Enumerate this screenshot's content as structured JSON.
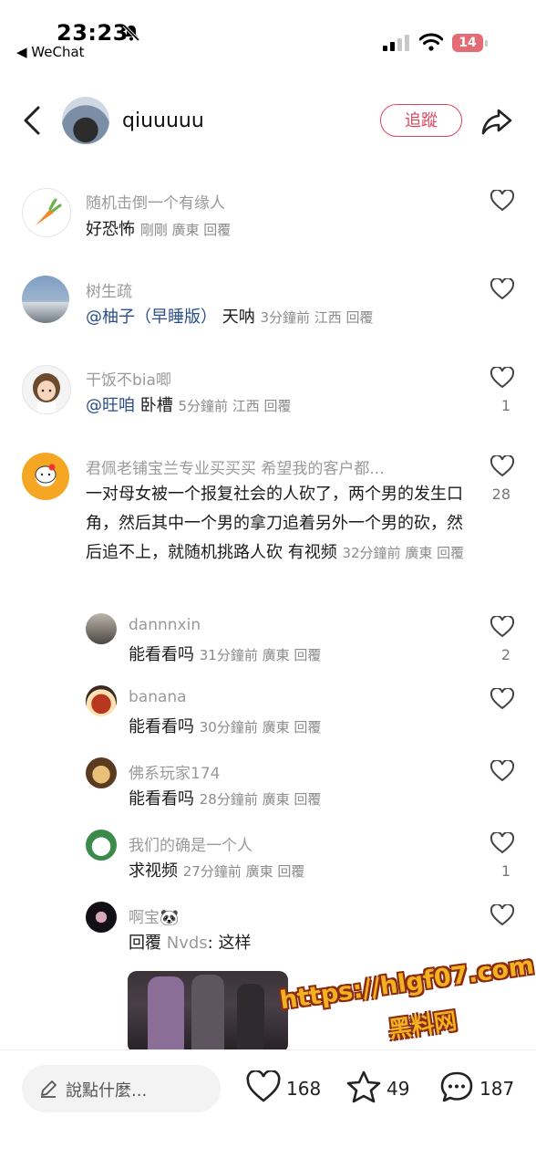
{
  "status_bar": {
    "time": "23:23",
    "back_app": "◀ WeChat",
    "battery": "14"
  },
  "header": {
    "username": "qiuuuuu",
    "follow_label": "追蹤"
  },
  "comments": [
    {
      "name": "随机击倒一个有缘人",
      "text": "好恐怖",
      "mention": "",
      "meta": "剛剛 廣東 回覆",
      "likes": ""
    },
    {
      "name": "树生疏",
      "mention": "@柚子（早睡版）",
      "text": "天呐",
      "meta": "3分鐘前 江西 回覆",
      "likes": ""
    },
    {
      "name": "干饭不bia唧",
      "mention": "@旺咱",
      "text": "卧槽",
      "meta": "5分鐘前 江西 回覆",
      "likes": "1"
    },
    {
      "name": "君佩老铺宝兰专业买买买 希望我的客户都...",
      "mention": "",
      "text": "一对母女被一个报复社会的人砍了，两个男的发生口角，然后其中一个男的拿刀追着另外一个男的砍，然后追不上，就随机挑路人砍 有视频",
      "meta": "32分鐘前 廣東 回覆",
      "likes": "28"
    }
  ],
  "replies": [
    {
      "name": "dannnxin",
      "text": "能看看吗",
      "meta": "31分鐘前 廣東 回覆",
      "likes": "2"
    },
    {
      "name": "banana",
      "text": "能看看吗",
      "meta": "30分鐘前 廣東 回覆",
      "likes": ""
    },
    {
      "name": "佛系玩家174",
      "text": "能看看吗",
      "meta": "28分鐘前 廣東 回覆",
      "likes": ""
    },
    {
      "name": "我们的确是一个人",
      "text": "求视频",
      "meta": "27分鐘前 廣東 回覆",
      "likes": "1"
    },
    {
      "name": "啊宝🐼",
      "text_prefix": "回覆",
      "reply_to": "Nvds",
      "text": ": 这样",
      "likes": ""
    }
  ],
  "watermark": {
    "url": "https://hlgf07.com",
    "sub": "黑料网"
  },
  "bottom_bar": {
    "input_placeholder": "說點什麼...",
    "likes_count": "168",
    "favorites_count": "49",
    "comments_count": "187"
  },
  "colors": {
    "accent": "#e0455e",
    "mention": "#2a4f86",
    "meta": "#8c8c8c"
  },
  "icons": [
    "bell-slash-icon",
    "signal-icon",
    "wifi-icon",
    "battery-icon",
    "back-chevron-icon",
    "share-icon",
    "heart-icon",
    "pencil-icon",
    "star-icon",
    "comment-bubble-icon"
  ]
}
